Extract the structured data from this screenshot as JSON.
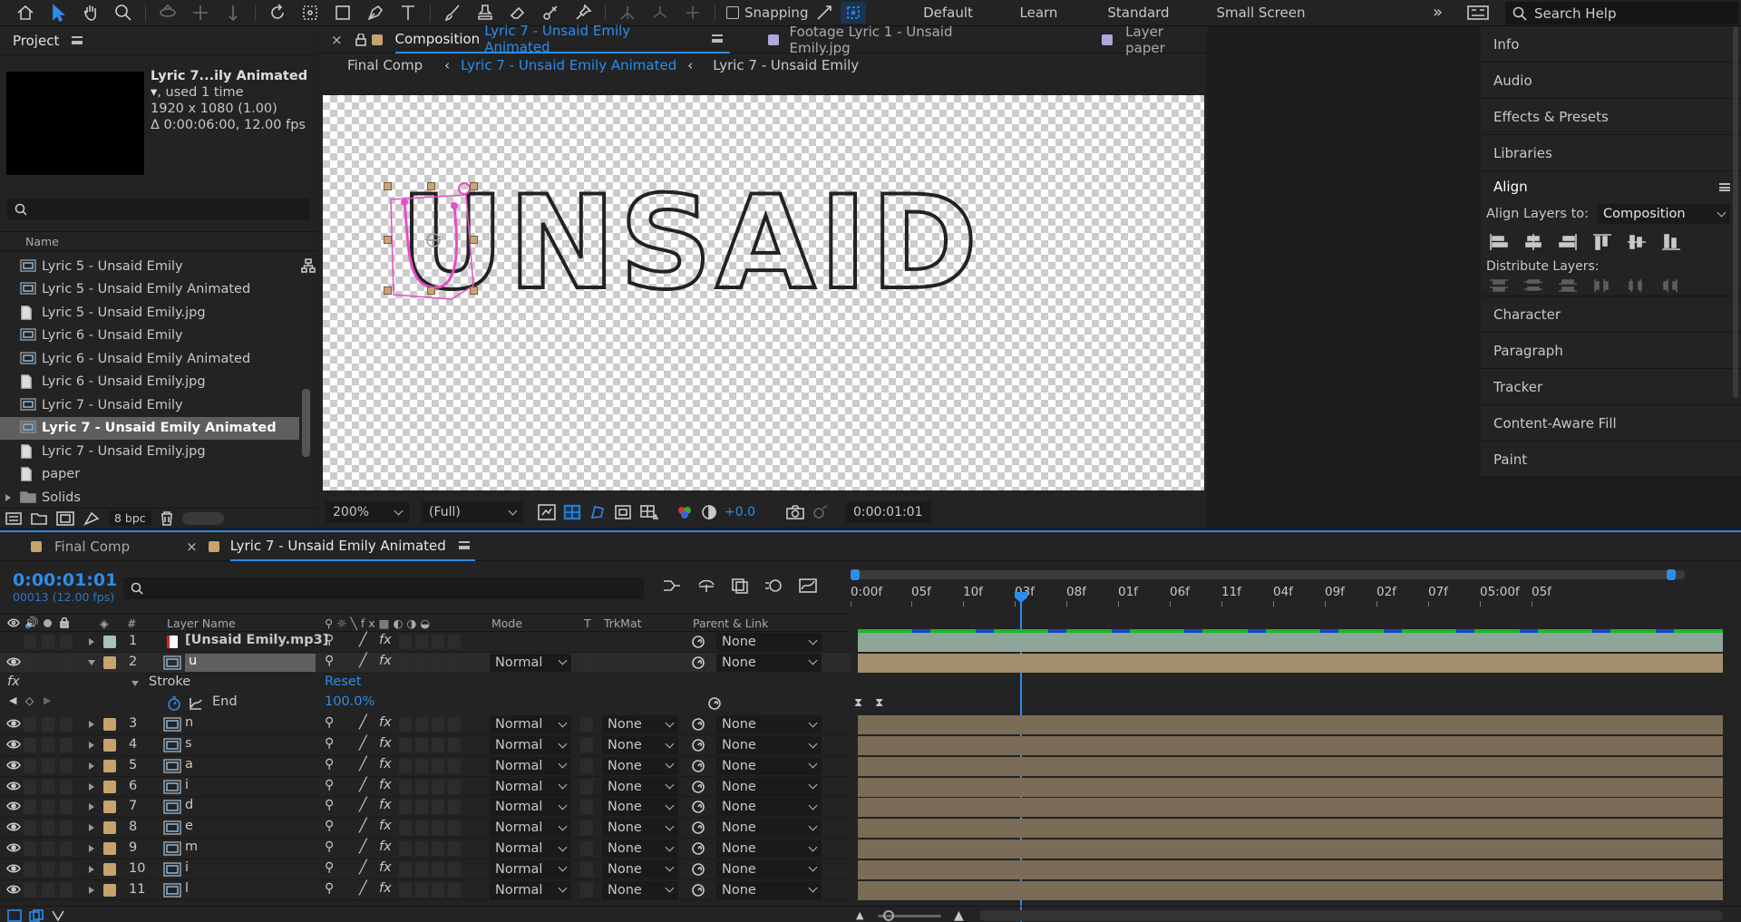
{
  "toolbar": {
    "snapping_label": "Snapping",
    "workspaces": [
      "Default",
      "Learn",
      "Standard",
      "Small Screen"
    ],
    "search_placeholder": "Search Help"
  },
  "project": {
    "title": "Project",
    "selected_name": "Lyric 7...ily Animated",
    "used": ", used 1 time",
    "dimensions": "1920 x 1080 (1.00)",
    "duration": "Δ 0:00:06:00, 12.00 fps",
    "col_name": "Name",
    "items": [
      {
        "label": "Lyric 5 - Unsaid Emily",
        "kind": "comp"
      },
      {
        "label": "Lyric 5 - Unsaid Emily Animated",
        "kind": "comp"
      },
      {
        "label": "Lyric 5 - Unsaid Emily.jpg",
        "kind": "file"
      },
      {
        "label": "Lyric 6 - Unsaid Emily",
        "kind": "comp"
      },
      {
        "label": "Lyric 6 - Unsaid Emily Animated",
        "kind": "comp"
      },
      {
        "label": "Lyric 6 - Unsaid Emily.jpg",
        "kind": "file"
      },
      {
        "label": "Lyric 7 - Unsaid Emily",
        "kind": "comp"
      },
      {
        "label": "Lyric 7 - Unsaid Emily Animated",
        "kind": "comp",
        "selected": true
      },
      {
        "label": "Lyric 7 - Unsaid Emily.jpg",
        "kind": "file"
      },
      {
        "label": "paper",
        "kind": "file"
      },
      {
        "label": "Solids",
        "kind": "folder"
      }
    ],
    "bpc": "8 bpc"
  },
  "comp": {
    "tab_prefix": "Composition",
    "tab_name": "Lyric 7 - Unsaid Emily Animated",
    "tab_footage": "Footage Lyric 1 - Unsaid Emily.jpg",
    "tab_layer": "Layer paper",
    "crumbs": [
      "Final Comp",
      "Lyric 7 - Unsaid Emily Animated",
      "Lyric 7 - Unsaid Emily"
    ],
    "art_text": "UNSAID",
    "zoom": "200%",
    "resolution": "(Full)",
    "exposure": "+0.0",
    "timecode": "0:00:01:01"
  },
  "right": {
    "items_top": [
      "Info",
      "Audio",
      "Effects & Presets",
      "Libraries"
    ],
    "align_title": "Align",
    "align_to_label": "Align Layers to:",
    "align_to_value": "Composition",
    "distribute_label": "Distribute Layers:",
    "items_bottom": [
      "Character",
      "Paragraph",
      "Tracker",
      "Content-Aware Fill",
      "Paint"
    ]
  },
  "timeline": {
    "tabs": [
      "Final Comp",
      "Lyric 7 - Unsaid Emily Animated"
    ],
    "timecode": "0:00:01:01",
    "frames": "00013 (12.00 fps)",
    "headers": {
      "num": "#",
      "layer": "Layer Name",
      "mode": "Mode",
      "t": "T",
      "trkmat": "TrkMat",
      "parent": "Parent & Link"
    },
    "ruler": [
      "0:00f",
      "05f",
      "10f",
      "03f",
      "08f",
      "01f",
      "06f",
      "11f",
      "04f",
      "09f",
      "02f",
      "07f",
      "05:00f",
      "05f"
    ],
    "stroke_label": "Stroke",
    "reset_label": "Reset",
    "end_label": "End",
    "end_value": "100.0%",
    "layers": [
      {
        "num": "1",
        "name": "[Unsaid Emily.mp3]",
        "mode": "",
        "trk": "",
        "parent": "None",
        "color": "#a5c4b3",
        "audio": true
      },
      {
        "num": "2",
        "name": "u",
        "mode": "Normal",
        "trk": "",
        "parent": "None",
        "color": "#c8a36e",
        "expanded": true
      },
      {
        "num": "3",
        "name": "n",
        "mode": "Normal",
        "trk": "None",
        "parent": "None",
        "color": "#c8a36e"
      },
      {
        "num": "4",
        "name": "s",
        "mode": "Normal",
        "trk": "None",
        "parent": "None",
        "color": "#c8a36e"
      },
      {
        "num": "5",
        "name": "a",
        "mode": "Normal",
        "trk": "None",
        "parent": "None",
        "color": "#c8a36e"
      },
      {
        "num": "6",
        "name": "i",
        "mode": "Normal",
        "trk": "None",
        "parent": "None",
        "color": "#c8a36e"
      },
      {
        "num": "7",
        "name": "d",
        "mode": "Normal",
        "trk": "None",
        "parent": "None",
        "color": "#c8a36e"
      },
      {
        "num": "8",
        "name": "e",
        "mode": "Normal",
        "trk": "None",
        "parent": "None",
        "color": "#c8a36e"
      },
      {
        "num": "9",
        "name": "m",
        "mode": "Normal",
        "trk": "None",
        "parent": "None",
        "color": "#c8a36e"
      },
      {
        "num": "10",
        "name": "i",
        "mode": "Normal",
        "trk": "None",
        "parent": "None",
        "color": "#c8a36e"
      },
      {
        "num": "11",
        "name": "l",
        "mode": "Normal",
        "trk": "None",
        "parent": "None",
        "color": "#c8a36e"
      }
    ]
  }
}
